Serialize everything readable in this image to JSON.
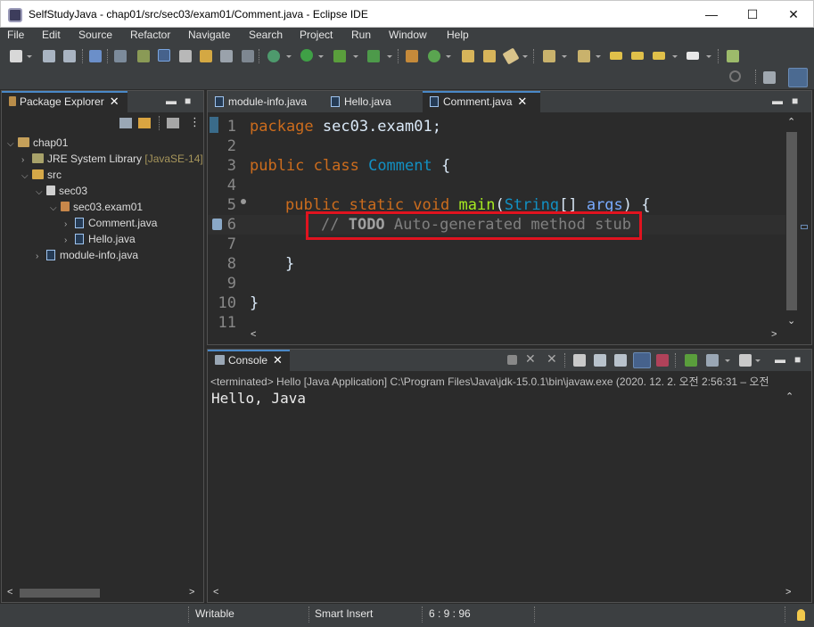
{
  "window": {
    "title": "SelfStudyJava - chap01/src/sec03/exam01/Comment.java - Eclipse IDE",
    "minimize": "—",
    "maximize": "☐",
    "close": "✕"
  },
  "menu": [
    "File",
    "Edit",
    "Source",
    "Refactor",
    "Navigate",
    "Search",
    "Project",
    "Run",
    "Window",
    "Help"
  ],
  "package_explorer": {
    "title": "Package Explorer",
    "tree": [
      {
        "label": "chap01",
        "depth": 0,
        "expanded": true,
        "icon": "project-icon"
      },
      {
        "label": "JRE System Library",
        "suffix": "[JavaSE-14]",
        "depth": 1,
        "expanded": false,
        "icon": "library-icon"
      },
      {
        "label": "src",
        "depth": 1,
        "expanded": true,
        "icon": "source-folder-icon"
      },
      {
        "label": "sec03",
        "depth": 2,
        "expanded": true,
        "icon": "package-icon"
      },
      {
        "label": "sec03.exam01",
        "depth": 3,
        "expanded": true,
        "icon": "package-icon"
      },
      {
        "label": "Comment.java",
        "depth": 4,
        "expanded": false,
        "icon": "java-file-icon"
      },
      {
        "label": "Hello.java",
        "depth": 4,
        "expanded": false,
        "icon": "java-file-icon"
      },
      {
        "label": "module-info.java",
        "depth": 1,
        "expanded": false,
        "icon": "java-file-icon"
      }
    ]
  },
  "editor": {
    "tabs": [
      {
        "label": "module-info.java",
        "active": false
      },
      {
        "label": "Hello.java",
        "active": false
      },
      {
        "label": "Comment.java",
        "active": true
      }
    ],
    "line_numbers": [
      "1",
      "2",
      "3",
      "4",
      "5",
      "6",
      "7",
      "8",
      "9",
      "10",
      "11"
    ],
    "code": {
      "l1_kw": "package",
      "l1_rest": " sec03.exam01;",
      "l3_kw": "public class",
      "l3_cls": "Comment",
      "l3_rest": " {",
      "l5_kw": "public static void",
      "l5_mth": "main",
      "l5_open": "(",
      "l5_type": "String",
      "l5_arr": "[] ",
      "l5_par": "args",
      "l5_close": ") {",
      "l6_cm1": "// ",
      "l6_todo": "TODO",
      "l6_cm2": " Auto-generated method stub",
      "l8": "}",
      "l10": "}"
    },
    "highlight_color": "#e0131f"
  },
  "console": {
    "title": "Console",
    "header": "<terminated> Hello [Java Application] C:\\Program Files\\Java\\jdk-15.0.1\\bin\\javaw.exe  (2020. 12. 2. 오전 2:56:31 – 오전",
    "output": "Hello, Java"
  },
  "status": {
    "mode": "Writable",
    "insert": "Smart Insert",
    "position": "6 : 9 : 96"
  }
}
